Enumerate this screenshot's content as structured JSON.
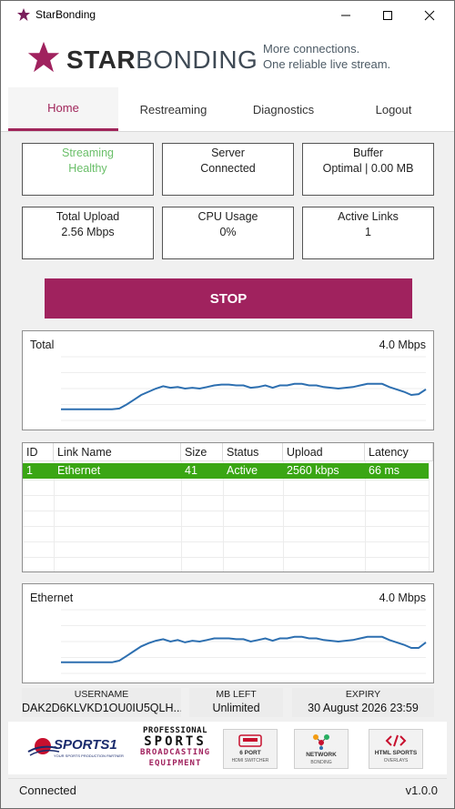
{
  "window": {
    "title": "StarBonding"
  },
  "brand": {
    "name_bold": "STAR",
    "name_light": "BONDING",
    "tagline_1": "More connections.",
    "tagline_2": "One reliable live stream.",
    "accent_color": "#a0225e"
  },
  "tabs": [
    {
      "label": "Home",
      "active": true
    },
    {
      "label": "Restreaming",
      "active": false
    },
    {
      "label": "Diagnostics",
      "active": false
    },
    {
      "label": "Logout",
      "active": false
    }
  ],
  "stats": [
    {
      "label": "Streaming",
      "value": "Healthy"
    },
    {
      "label": "Server",
      "value": "Connected"
    },
    {
      "label": "Buffer",
      "value": "Optimal | 0.00 MB"
    },
    {
      "label": "Total Upload",
      "value": "2.56 Mbps"
    },
    {
      "label": "CPU Usage",
      "value": "0%"
    },
    {
      "label": "Active Links",
      "value": "1"
    }
  ],
  "stop_button": {
    "label": "STOP"
  },
  "total_chart": {
    "label": "Total",
    "max_label": "4.0 Mbps",
    "max": 4.0,
    "values": [
      0.7,
      0.7,
      0.7,
      0.7,
      0.7,
      0.7,
      0.7,
      0.7,
      0.75,
      1.0,
      1.3,
      1.6,
      1.8,
      2.0,
      2.15,
      2.05,
      2.1,
      2.0,
      2.05,
      2.0,
      2.1,
      2.2,
      2.25,
      2.25,
      2.2,
      2.2,
      2.05,
      2.1,
      2.2,
      2.05,
      2.2,
      2.2,
      2.3,
      2.3,
      2.2,
      2.2,
      2.1,
      2.05,
      2.0,
      2.05,
      2.1,
      2.2,
      2.3,
      2.3,
      2.3,
      2.1,
      1.95,
      1.8,
      1.6,
      1.65,
      1.95
    ]
  },
  "table": {
    "columns": [
      "ID",
      "Link Name",
      "Size",
      "Status",
      "Upload",
      "Latency"
    ],
    "rows": [
      {
        "id": "1",
        "name": "Ethernet",
        "size": "41",
        "status": "Active",
        "upload": "2560 kbps",
        "latency": "66 ms"
      }
    ],
    "selected_color": "#3aa614"
  },
  "ethernet_chart": {
    "label": "Ethernet",
    "max_label": "4.0 Mbps",
    "max": 4.0,
    "values": [
      0.7,
      0.7,
      0.7,
      0.7,
      0.7,
      0.7,
      0.7,
      0.7,
      0.8,
      1.1,
      1.4,
      1.7,
      1.9,
      2.05,
      2.15,
      2.0,
      2.1,
      1.95,
      2.05,
      2.0,
      2.1,
      2.2,
      2.2,
      2.2,
      2.15,
      2.15,
      2.0,
      2.1,
      2.2,
      2.05,
      2.2,
      2.2,
      2.3,
      2.3,
      2.2,
      2.2,
      2.1,
      2.05,
      2.0,
      2.05,
      2.1,
      2.2,
      2.3,
      2.3,
      2.3,
      2.1,
      1.95,
      1.8,
      1.6,
      1.6,
      1.95
    ]
  },
  "account": {
    "username_label": "USERNAME",
    "username_value": "DAK2D6KLVKD1OU0IU5QLH...",
    "mbleft_label": "MB LEFT",
    "mbleft_value": "Unlimited",
    "expiry_label": "EXPIRY",
    "expiry_value": "30 August 2026 23:59"
  },
  "logos": {
    "sports1": "SPORTS1",
    "sports1_sub": "YOUR SPORTS PRODUCTION PARTNER",
    "pro_line1": "PROFESSIONAL",
    "pro_line2": "SPORTS",
    "pro_line3": "BROADCASTING",
    "pro_line4": "EQUIPMENT",
    "products": [
      {
        "title": "6 PORT",
        "sub": "HDMI SWITCHER",
        "icon": "hdmi-port-icon"
      },
      {
        "title": "NETWORK",
        "sub": "BONDING",
        "icon": "network-nodes-icon"
      },
      {
        "title": "HTML SPORTS",
        "sub": "OVERLAYS",
        "icon": "code-icon"
      }
    ]
  },
  "status_bar": {
    "status": "Connected",
    "version": "v1.0.0"
  }
}
